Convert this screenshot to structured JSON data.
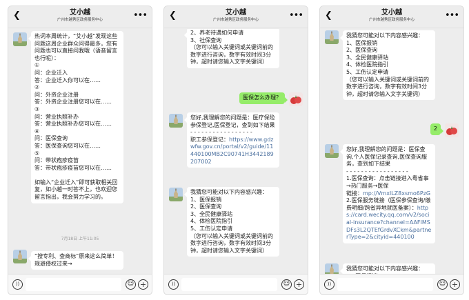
{
  "screens": [
    {
      "title": "艾小越",
      "subtitle": "广州市越秀区政务服务中心",
      "msg1": "热词本周统计，“艾小越”发现这些问题这周企业群众问得最多，您有问题也可以直接问我哦（语音留言也行呢）：\n①\n问：企业迁入\n答：企业迁入你可以在……\n②\n问：外资企业注册\n答：外资企业注册您可以在……\n③\n问：营业执照补办\n答：营业执照补办您可以在……\n④\n问：医保查询\n答：医保查询您可以在……\n⑤\n问：带状疱疹疫苗\n答：带状疱疹疫苗您可以在……\n\n如输入“企业迁入”即可获取相关回复，如小越一时答不上，也欢迎您留言指出，我会努力学习的。",
      "timestamp": "7月18日 上午11:05",
      "msg2": "“搜专利、查商标”原来这么简单！规避侵权过来→"
    },
    {
      "title": "艾小越",
      "subtitle": "广州市越秀区政务服务中心",
      "msg1": "2、养老待遇如何申请\n3、社保查询\n（您可以输入关键词或关键词前的数字进行咨询，数字有效时间3分钟，超时请您输入文字关键词）",
      "user_msg": "医保怎么办理？",
      "msg2_text": "您好,我理解您的问题是：医疗保险参保登记,医保登记，查到如下结果\n- - - - - - - - - - - - - - - - - \n职工参保登记：",
      "msg2_link": "https://www.gdzwfw.gov.cn/portal/v2/guide/11440100MB2C90741H3442189207002",
      "msg3": "我猜您可能对以下内容感兴趣：\n1、医保报销\n2、医保查询\n3、全民健康驿站\n4、体检医院指引\n5、工伤认定申请\n（您可以输入关键词或关键词前的数字进行咨询，数字有效时间3分钟，超时请您输入文字关键词）"
    },
    {
      "title": "艾小越",
      "subtitle": "广州市越秀区政务服务中心",
      "msg1": "我猜您可能对以下内容感兴趣：\n1、医保报销\n2、医保查询\n3、全民健康驿站\n4、体检医院指引\n5、工伤认定申请\n（您可以输入关键词或关键词前的数字进行咨询，数字有效时间3分钟，超时请您输入文字关键词）",
      "user_msg": "2",
      "msg2_a": "您好,我理解您的问题是：医保查询,个人医保记录查询,医保查询服务，查到如下结果\n- - - - - - - - - - - - - - - - - \n1.医保查询：点击链接进入粤省事→热门服务→医保\n链接：",
      "msg2_link1": "mp://VmxlLZ8xsmo6PzG",
      "msg2_b": "\n2.医保服务链接（医保参保查询/缴费明细/跨省异地就医备案）：",
      "msg2_link2": "https://card.wecity.qq.com/v2/social-insurance?channel=AAFIMSDFs3L2QTEfGrdvXCkm&partnerType=2&cityid=440100",
      "msg3": "我猜您可能对以下内容感兴趣：\n1、医保报销"
    }
  ]
}
